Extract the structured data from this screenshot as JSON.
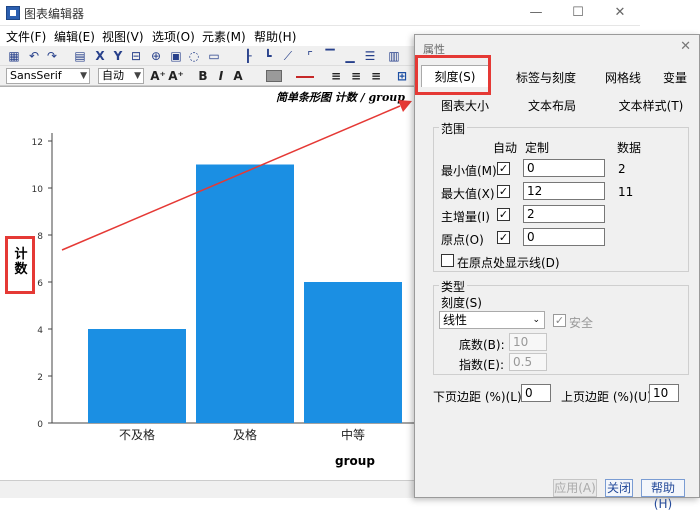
{
  "window": {
    "title": "图表编辑器",
    "min": "—",
    "max": "☐",
    "close": "✕"
  },
  "menu": [
    "文件(F)",
    "编辑(E)",
    "视图(V)",
    "选项(O)",
    "元素(M)",
    "帮助(H)"
  ],
  "toolbar": {
    "font_family": "SansSerif",
    "font_size": "自动",
    "bold": "B",
    "italic": "I",
    "grow_font": "A⁺",
    "shrink_font": "A⁺"
  },
  "chart": {
    "title": "简单条形图 计数 / group",
    "ylabel": "计数",
    "xlabel": "group",
    "bar_color": "#1b8fe3"
  },
  "chart_data": {
    "type": "bar",
    "title": "简单条形图 计数 / group",
    "categories": [
      "不及格",
      "及格",
      "中等"
    ],
    "values": [
      4,
      11,
      6
    ],
    "xlabel": "group",
    "ylabel": "计数",
    "ylim": [
      0,
      12
    ],
    "yticks": [
      "0",
      "2",
      "4",
      "6",
      "8",
      "10",
      "12"
    ],
    "grid": false
  },
  "dialog": {
    "title": "属性",
    "close": "✕",
    "tabs_row1": [
      "刻度(S)",
      "标签与刻度",
      "网格线",
      "变量"
    ],
    "tabs_row2": [
      "图表大小",
      "文本布局",
      "文本样式(T)"
    ],
    "range": {
      "label": "范围",
      "col_auto": "自动",
      "col_custom": "定制",
      "col_data": "数据",
      "rows": [
        {
          "label": "最小值(M)",
          "auto": "✓",
          "value": "0",
          "data": "2"
        },
        {
          "label": "最大值(X)",
          "auto": "✓",
          "value": "12",
          "data": "11"
        },
        {
          "label": "主增量(I)",
          "auto": "✓",
          "value": "2",
          "data": ""
        },
        {
          "label": "原点(O)",
          "auto": "✓",
          "value": "0",
          "data": ""
        }
      ],
      "origin_line_label": "在原点处显示线(D)"
    },
    "type": {
      "label": "类型",
      "scale_label": "刻度(S)",
      "scale_value": "线性",
      "safe_label": "安全",
      "base_label": "底数(B):",
      "base_value": "10",
      "exponent_label": "指数(E):",
      "exponent_value": "0.5"
    },
    "margins": {
      "lower_label": "下页边距 (%)(L):",
      "lower_value": "0",
      "upper_label": "上页边距 (%)(U):",
      "upper_value": "10"
    },
    "buttons": {
      "apply": "应用(A)",
      "close": "关闭",
      "help": "帮助(H)"
    }
  },
  "annotation_color": "#e53935"
}
